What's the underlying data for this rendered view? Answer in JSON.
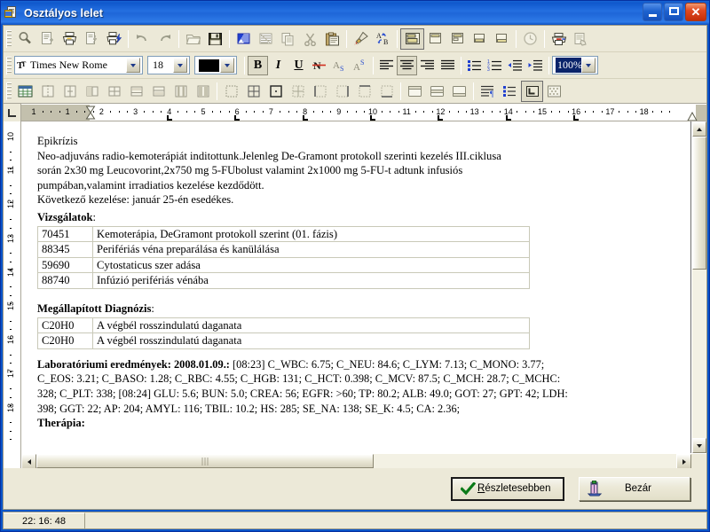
{
  "window": {
    "title": "Osztályos lelet",
    "icon": "app-document-icon",
    "controls": {
      "minimize": "Minimize",
      "maximize": "Maximize",
      "close": "Close"
    }
  },
  "toolbar_main": {
    "items": [
      {
        "name": "print-preview-icon",
        "tip": "Nyomtatási kép",
        "enabled": false
      },
      {
        "name": "new-document-icon",
        "tip": "Új dokumentum",
        "enabled": false
      },
      {
        "name": "print-icon",
        "tip": "Nyomtatás",
        "enabled": true
      },
      {
        "name": "document-quick-icon",
        "tip": "Gyors dokumentum",
        "enabled": false
      },
      {
        "name": "quick-print-icon",
        "tip": "Gyors nyomtatás",
        "enabled": true
      },
      {
        "name": "undo-icon",
        "tip": "Visszavonás",
        "enabled": false
      },
      {
        "name": "redo-icon",
        "tip": "Mégis",
        "enabled": false
      },
      {
        "name": "open-folder-icon",
        "tip": "Megnyitás",
        "enabled": false
      },
      {
        "name": "save-icon",
        "tip": "Mentés",
        "enabled": true
      },
      {
        "name": "text-block-icon",
        "tip": "Szövegblokk",
        "enabled": true
      },
      {
        "name": "text-lines-icon",
        "tip": "Sorok",
        "enabled": false
      },
      {
        "name": "copy-icon",
        "tip": "Másolás",
        "enabled": false
      },
      {
        "name": "cut-icon",
        "tip": "Kivágás",
        "enabled": false
      },
      {
        "name": "paste-icon",
        "tip": "Beillesztés",
        "enabled": true
      },
      {
        "name": "format-painter-icon",
        "tip": "Formátummásoló",
        "enabled": true
      },
      {
        "name": "find-replace-icon",
        "tip": "Keresés és csere",
        "enabled": true
      },
      {
        "name": "layout-1-icon",
        "tip": "Elrendezés 1",
        "enabled": true,
        "active": true
      },
      {
        "name": "layout-2-icon",
        "tip": "Elrendezés 2",
        "enabled": true
      },
      {
        "name": "layout-3-icon",
        "tip": "Elrendezés 3",
        "enabled": true
      },
      {
        "name": "layout-4-icon",
        "tip": "Elrendezés 4",
        "enabled": true
      },
      {
        "name": "layout-5-icon",
        "tip": "Elrendezés 5",
        "enabled": true
      },
      {
        "name": "clock-icon",
        "tip": "Óra",
        "enabled": false
      },
      {
        "name": "printer-red-icon",
        "tip": "Nyomtató",
        "enabled": true
      },
      {
        "name": "document-hand-icon",
        "tip": "Dokumentum",
        "enabled": false
      }
    ]
  },
  "toolbar_format": {
    "font_name": "Times New Rome",
    "font_size": "18",
    "font_color": "#000000",
    "zoom": "100%",
    "buttons": [
      {
        "name": "bold-button",
        "label": "B",
        "active": true
      },
      {
        "name": "italic-button",
        "label": "I",
        "active": false
      },
      {
        "name": "underline-button",
        "label": "U",
        "active": false
      },
      {
        "name": "strikethrough-button",
        "label": "N",
        "active": false
      },
      {
        "name": "subscript-button",
        "label": "A",
        "active": false
      },
      {
        "name": "superscript-button",
        "label": "A",
        "active": false
      }
    ],
    "align": [
      {
        "name": "align-left-button",
        "active": false
      },
      {
        "name": "align-center-button",
        "active": true
      },
      {
        "name": "align-right-button",
        "active": false
      },
      {
        "name": "align-justify-button",
        "active": false
      }
    ],
    "lists": [
      {
        "name": "bullet-list-button"
      },
      {
        "name": "numbered-list-button"
      },
      {
        "name": "decrease-indent-button"
      },
      {
        "name": "increase-indent-button"
      }
    ]
  },
  "toolbar_table": {
    "items": [
      {
        "name": "insert-table-icon",
        "enabled": true
      },
      {
        "name": "split-cell-vertical-icon",
        "enabled": false
      },
      {
        "name": "merge-cell-icon",
        "enabled": false
      },
      {
        "name": "insert-column-icon",
        "enabled": false
      },
      {
        "name": "insert-row-icon",
        "enabled": false
      },
      {
        "name": "merge-rows-icon",
        "enabled": false
      },
      {
        "name": "split-rows-icon",
        "enabled": false
      },
      {
        "name": "column-width-icon",
        "enabled": false
      },
      {
        "name": "column-dist-icon",
        "enabled": false
      },
      {
        "name": "border-none-icon",
        "enabled": false
      },
      {
        "name": "border-all-icon",
        "enabled": true
      },
      {
        "name": "border-box-icon",
        "enabled": true
      },
      {
        "name": "border-inner-icon",
        "enabled": false
      },
      {
        "name": "border-left-icon",
        "enabled": false
      },
      {
        "name": "border-right-icon",
        "enabled": false
      },
      {
        "name": "border-top-icon",
        "enabled": false
      },
      {
        "name": "border-bottom-icon",
        "enabled": false
      },
      {
        "name": "border-outer-icon",
        "enabled": false
      },
      {
        "name": "header-row-icon",
        "enabled": true
      },
      {
        "name": "middle-row-icon",
        "enabled": true
      },
      {
        "name": "footer-row-icon",
        "enabled": true
      },
      {
        "name": "paragraph-mark-icon",
        "enabled": true
      },
      {
        "name": "list-properties-icon",
        "enabled": true
      },
      {
        "name": "corner-anchor-icon",
        "enabled": true
      },
      {
        "name": "insert-image-icon",
        "enabled": true
      }
    ]
  },
  "ruler": {
    "horizontal_ticks": [
      "1",
      "1",
      "2",
      "3",
      "4",
      "5",
      "6",
      "7",
      "8",
      "9",
      "10",
      "11",
      "12",
      "13",
      "14",
      "15",
      "16",
      "17",
      "18"
    ],
    "vertical_ticks": [
      "10",
      "11",
      "12",
      "13",
      "14",
      "15",
      "16",
      "17",
      "18"
    ]
  },
  "document": {
    "heading": "Epikrízis",
    "paragraphs": [
      "Neo-adjuváns radio-kemoterápiát inditottunk.Jelenleg De-Gramont protokoll  szerinti kezelés III.ciklusa",
      "során 2x30 mg Leucovorint,2x750 mg 5-FUbolust valamint 2x1000 mg 5-FU-t adtunk infusiós",
      "pumpában,valamint irradiatios  kezelése kezdődött.",
      "Következő kezelése: január 25-én esedékes."
    ],
    "exams": {
      "title": "Vizsgálatok",
      "title_suffix": ":",
      "rows": [
        {
          "code": "70451",
          "desc": "Kemoterápia, DeGramont protokoll szerint (01. fázis)"
        },
        {
          "code": "88345",
          "desc": "Perifériás véna preparálása és kanülálása"
        },
        {
          "code": "59690",
          "desc": "Cytostaticus szer adása"
        },
        {
          "code": "88740",
          "desc": "Infúzió perifériás vénába"
        }
      ]
    },
    "diagnosis": {
      "title": "Megállapított Diagnózis",
      "title_suffix": ":",
      "rows": [
        {
          "code": "C20H0",
          "desc": "A végbél rosszindulatú daganata"
        },
        {
          "code": "C20H0",
          "desc": "A végbél rosszindulatú daganata"
        }
      ]
    },
    "lab": {
      "title": "Laboratóriumi eredmények: 2008.01.09.:",
      "line1_rest": " [08:23] C_WBC: 6.75; C_NEU: 84.6; C_LYM: 7.13; C_MONO: 3.77;",
      "line2": "C_EOS: 3.21; C_BASO: 1.28; C_RBC: 4.55; C_HGB: 131; C_HCT: 0.398; C_MCV: 87.5; C_MCH: 28.7; C_MCHC:",
      "line3": "328; C_PLT: 338; [08:24] GLU: 5.6; BUN: 5.0; CREA: 56; EGFR: >60; TP: 80.2; ALB: 49.0; GOT: 27; GPT: 42; LDH:",
      "line4": "398; GGT: 22; AP: 204; AMYL: 116; TBIL: 10.2; HS: 285; SE_NA: 138; SE_K: 4.5; CA: 2.36;"
    },
    "therapy_title": "Therápia:"
  },
  "buttons": {
    "details": {
      "label_prefix": "R",
      "label_rest": "észletesebben",
      "icon": "check-icon"
    },
    "close": {
      "label": "Bezár",
      "icon": "exit-door-icon"
    }
  },
  "statusbar": {
    "clock": "22: 16: 48"
  }
}
